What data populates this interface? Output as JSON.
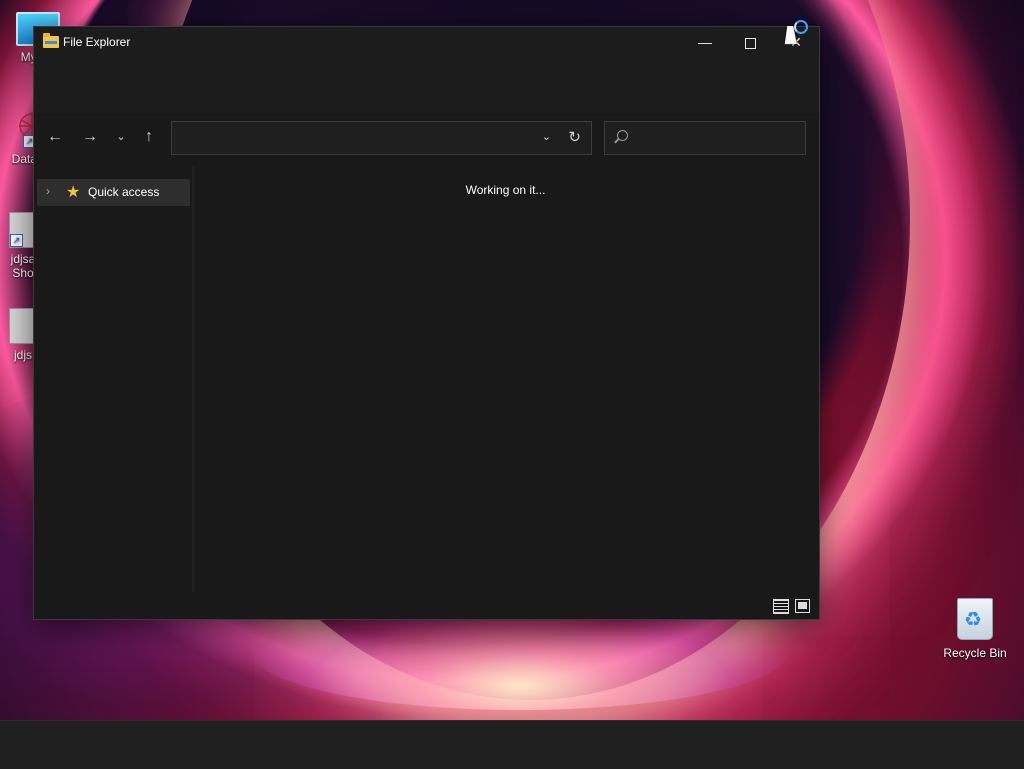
{
  "desktop": {
    "icons": [
      {
        "label": "My Co",
        "icon": "monitor-icon"
      },
      {
        "label": "DataW",
        "icon": "app-shortcut-icon"
      },
      {
        "label": "jdjsa",
        "label2": "Sho",
        "icon": "file-shortcut-icon"
      },
      {
        "label": "jdjs",
        "icon": "file-icon"
      },
      {
        "label": "Recycle Bin",
        "icon": "recycle-bin-icon"
      }
    ]
  },
  "window": {
    "title": "File Explorer",
    "icon": "folder-icon",
    "controls": {
      "minimize": "—",
      "close": "✕"
    },
    "nav": {
      "back": "←",
      "forward": "→",
      "recent": "⌄",
      "up": "↑"
    },
    "address": {
      "value": "",
      "dropdown": "⌄",
      "refresh": "↻"
    },
    "search": {
      "placeholder": ""
    },
    "nav_pane": {
      "items": [
        {
          "label": "Quick access",
          "icon": "star-icon",
          "chevron": "›"
        }
      ]
    },
    "content": {
      "status_text": "Working on it..."
    },
    "statusbar": {
      "view_buttons": [
        "details-view-icon",
        "large-icons-view-icon"
      ]
    }
  },
  "colors": {
    "window_bg": "#191919",
    "accent": "#3aa0ff",
    "star": "#f6c33b"
  }
}
